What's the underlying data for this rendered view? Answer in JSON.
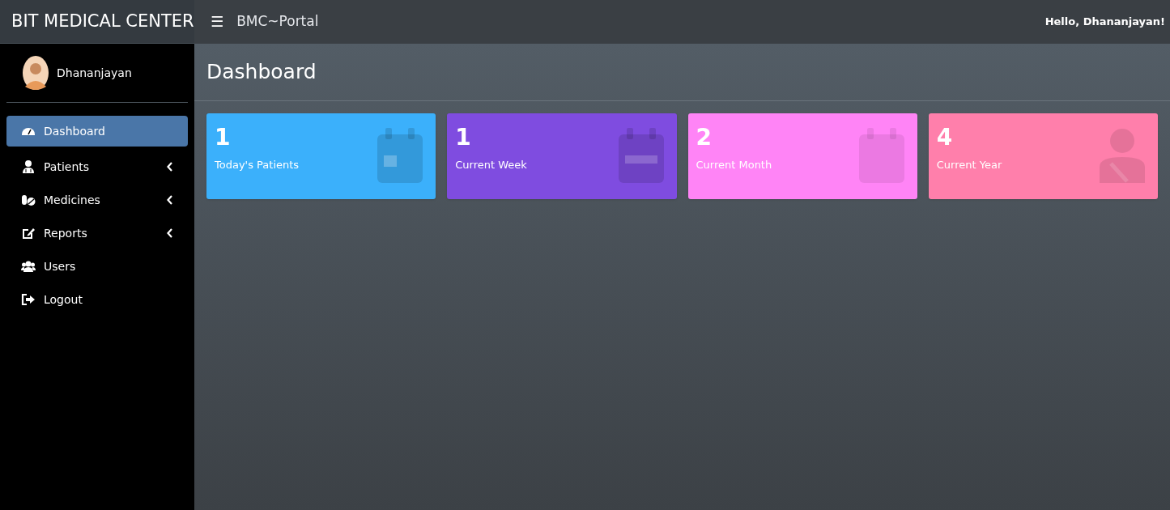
{
  "brand": "BIT MEDICAL CENTER",
  "topbar": {
    "menu_icon": "☰",
    "title": "BMC~Portal",
    "greeting": "Hello, Dhananjayan!"
  },
  "sidebar": {
    "user": {
      "name": "Dhananjayan"
    },
    "items": [
      {
        "label": "Dashboard",
        "kind": "gauge",
        "has_submenu": false,
        "selected": true
      },
      {
        "label": "Patients",
        "kind": "doctor",
        "has_submenu": true,
        "selected": false
      },
      {
        "label": "Medicines",
        "kind": "pills",
        "has_submenu": true,
        "selected": false
      },
      {
        "label": "Reports",
        "kind": "edit",
        "has_submenu": true,
        "selected": false
      },
      {
        "label": "Users",
        "kind": "users",
        "has_submenu": false,
        "selected": false
      },
      {
        "label": "Logout",
        "kind": "logout",
        "has_submenu": false,
        "selected": false
      }
    ]
  },
  "page_title": "Dashboard",
  "cards": [
    {
      "value": "1",
      "label": "Today's Patients",
      "color": "#3bb0fb",
      "kind": "day"
    },
    {
      "value": "1",
      "label": "Current Week",
      "color": "#7f4ce0",
      "kind": "week"
    },
    {
      "value": "2",
      "label": "Current Month",
      "color": "#ff84f6",
      "kind": "month"
    },
    {
      "value": "4",
      "label": "Current Year",
      "color": "#ff7fab",
      "kind": "year"
    }
  ]
}
